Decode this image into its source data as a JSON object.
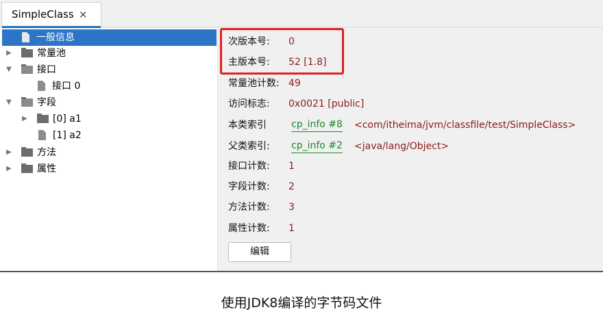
{
  "tab": {
    "title": "SimpleClass",
    "close": "×"
  },
  "tree": {
    "general": "一般信息",
    "constant_pool": "常量池",
    "interfaces": "接口",
    "interface_0": "接口 0",
    "fields": "字段",
    "field_0": "[0] a1",
    "field_1": "[1] a2",
    "methods": "方法",
    "attributes": "属性"
  },
  "details": {
    "minor_version": {
      "label": "次版本号:",
      "value": "0"
    },
    "major_version": {
      "label": "主版本号:",
      "value": "52 [1.8]"
    },
    "constant_pool_count": {
      "label": "常量池计数:",
      "value": "49"
    },
    "access_flags": {
      "label": "访问标志:",
      "value": "0x0021 [public]"
    },
    "this_class": {
      "label": "本类索引",
      "link": "cp_info #8",
      "ref": "<com/itheima/jvm/classfile/test/SimpleClass>"
    },
    "super_class": {
      "label": "父类索引:",
      "link": "cp_info #2",
      "ref": "<java/lang/Object>"
    },
    "interfaces_count": {
      "label": "接口计数:",
      "value": "1"
    },
    "fields_count": {
      "label": "字段计数:",
      "value": "2"
    },
    "methods_count": {
      "label": "方法计数:",
      "value": "3"
    },
    "attributes_count": {
      "label": "属性计数:",
      "value": "1"
    },
    "edit_button": "编辑"
  },
  "caption": "使用JDK8编译的字节码文件",
  "colors": {
    "selection": "#2b74c6",
    "value": "#8b1a1a",
    "link": "#1a8a2a",
    "highlight": "#e01f1f"
  }
}
